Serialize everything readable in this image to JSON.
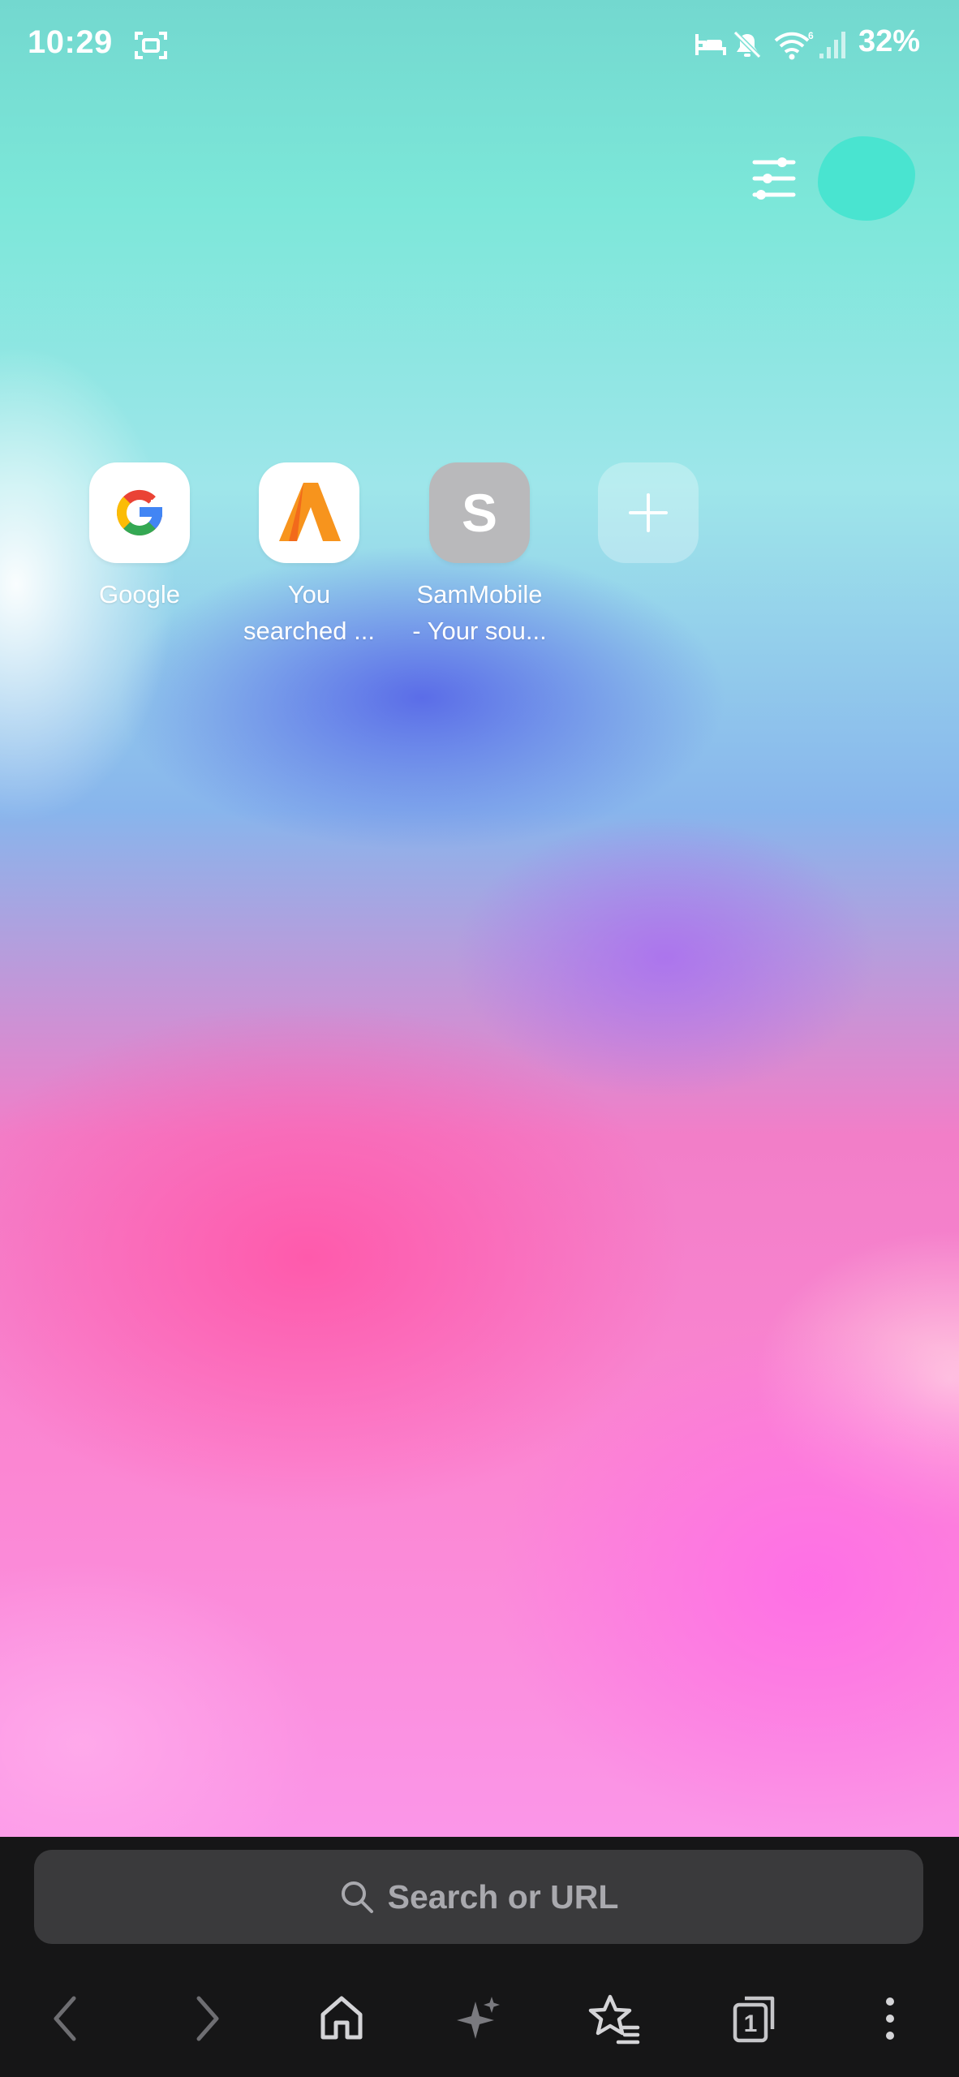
{
  "status_bar": {
    "time": "10:29",
    "battery": "32%",
    "icons": [
      "screenshot-icon",
      "sleep-mode-icon",
      "mute-icon",
      "wifi-6-icon",
      "signal-icon"
    ]
  },
  "top_actions": {
    "customize_icon": "sliders-icon",
    "profile_color": "#49e4d0"
  },
  "shortcuts": [
    {
      "label": "Google",
      "icon": "google-logo"
    },
    {
      "label": "You\nsearched ...",
      "icon": "aptoide-a-logo",
      "color": "#f7941d"
    },
    {
      "label": "SamMobile\n- Your sou...",
      "icon_letter": "S",
      "color": "#b9b9bb"
    },
    {
      "label": "",
      "icon": "plus-icon"
    }
  ],
  "search": {
    "placeholder": "Search or URL",
    "icon": "search-icon"
  },
  "bottom_nav": {
    "items": [
      "back-icon",
      "forward-icon",
      "home-icon",
      "sparkle-icon",
      "bookmarks-icon",
      "tabs-icon",
      "more-icon"
    ],
    "tab_count": "1"
  }
}
